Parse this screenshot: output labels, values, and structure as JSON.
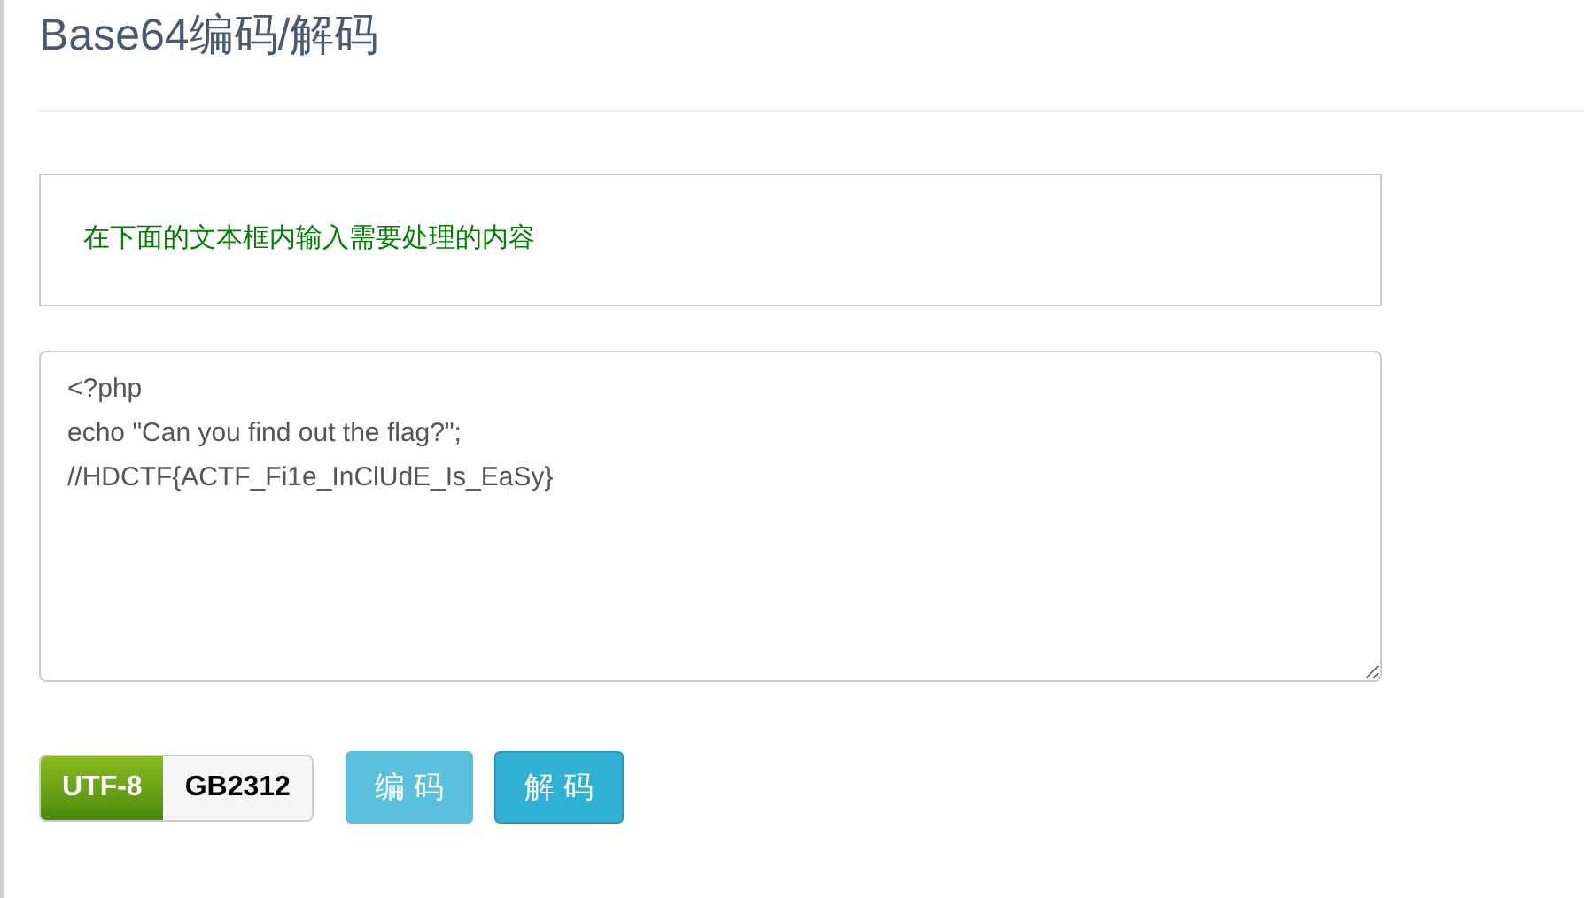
{
  "title": "Base64编码/解码",
  "notice": "在下面的文本框内输入需要处理的内容",
  "editor": {
    "value": "<?php\necho \"Can you find out the flag?\";\n//HDCTF{ACTF_Fi1e_InClUdE_Is_EaSy}"
  },
  "encodings": [
    {
      "label": "UTF-8",
      "selected": true
    },
    {
      "label": "GB2312",
      "selected": false
    }
  ],
  "buttons": [
    {
      "label": "编 码",
      "hovered": true
    },
    {
      "label": "解 码",
      "hovered": false
    }
  ]
}
